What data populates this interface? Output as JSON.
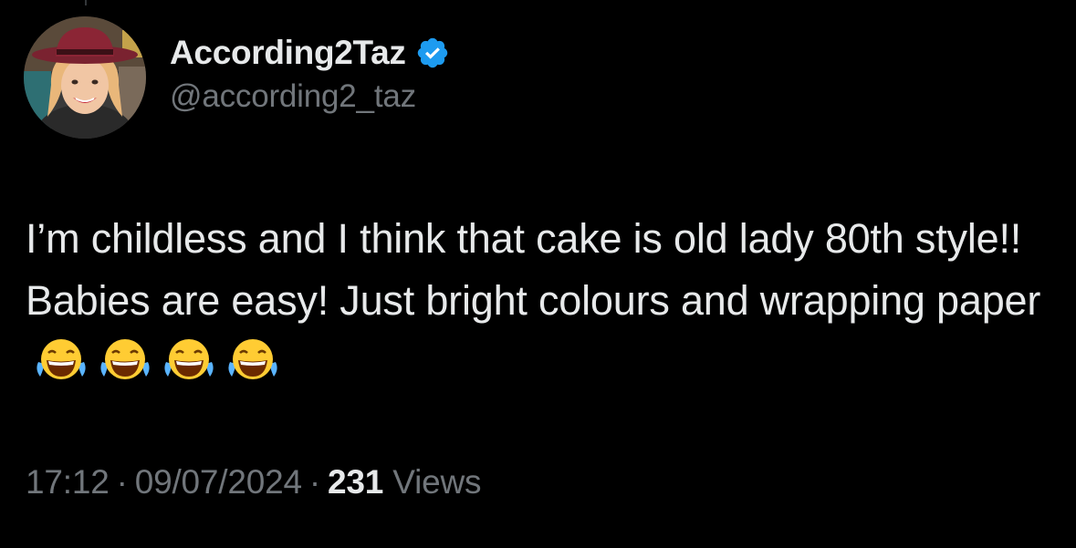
{
  "author": {
    "display_name": "According2Taz",
    "handle": "@according2_taz",
    "verified": true,
    "verified_color": "#1d9bf0"
  },
  "tweet": {
    "text": "I’m childless and I think that cake is old lady 80th style!! Babies are easy! Just bright colours and wrapping paper",
    "emoji": [
      "😂",
      "😂",
      "😂",
      "😂"
    ]
  },
  "meta": {
    "time": "17:12",
    "date": "09/07/2024",
    "separator": "·",
    "views_count": "231",
    "views_label": "Views"
  },
  "colors": {
    "background": "#000000",
    "primary_text": "#e7e9ea",
    "secondary_text": "#71767b",
    "accent": "#1d9bf0"
  },
  "icons": {
    "verified": "verified-badge-icon",
    "emoji": "face-with-tears-of-joy-icon"
  }
}
